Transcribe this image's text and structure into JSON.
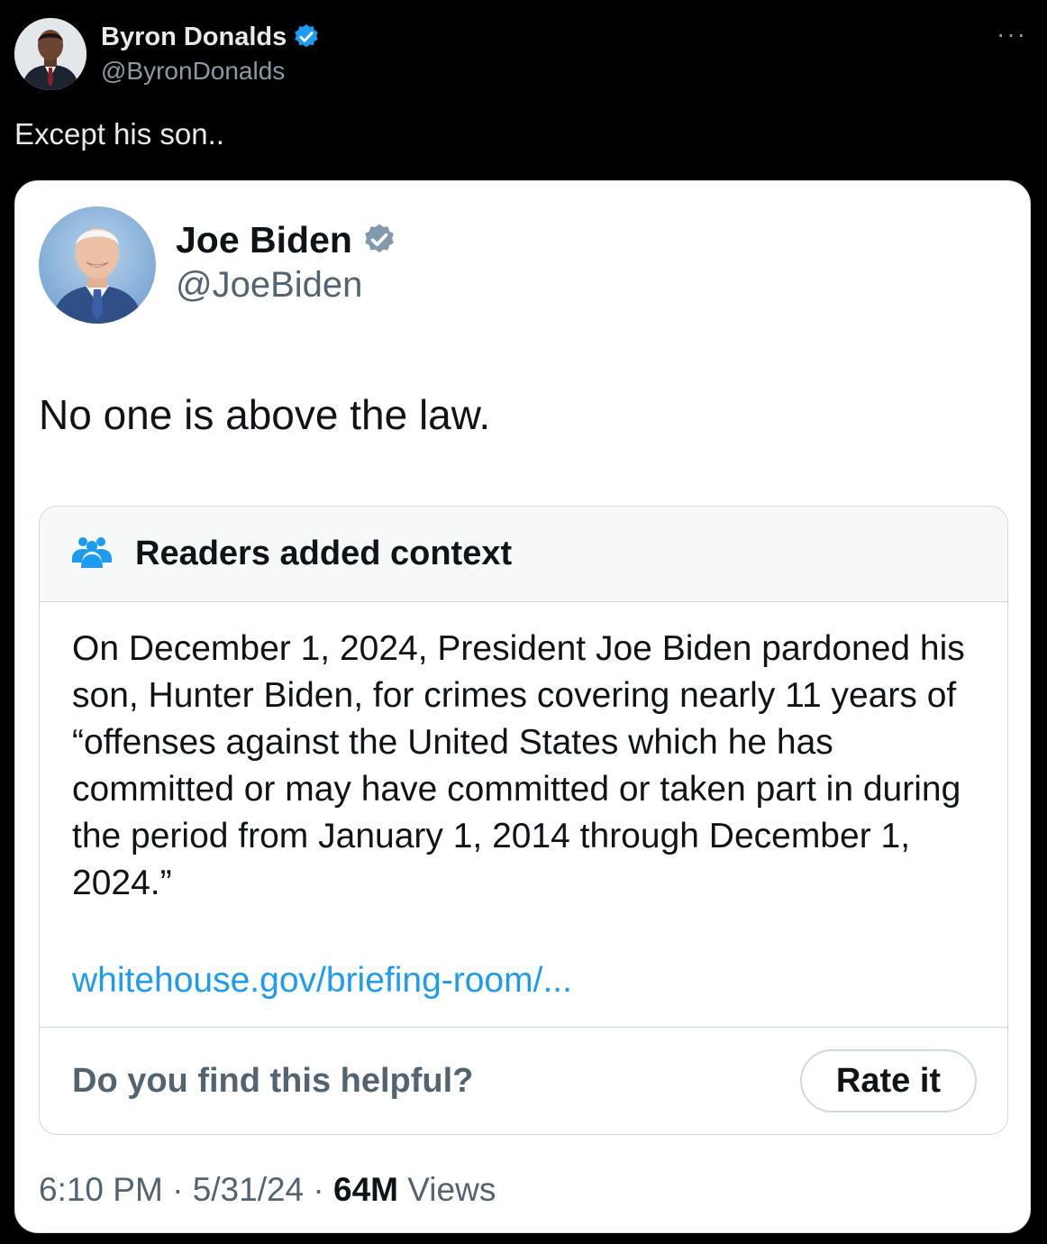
{
  "outer_tweet": {
    "author_name": "Byron Donalds",
    "author_handle": "@ByronDonalds",
    "more_label": "···",
    "text": "Except his son.."
  },
  "quoted_tweet": {
    "author_name": "Joe Biden",
    "author_handle": "@JoeBiden",
    "text": "No one is above the law.",
    "community_note": {
      "title": "Readers added context",
      "body": "On December 1, 2024, President Joe Biden pardoned his son, Hunter Biden, for crimes covering nearly 11 years of “offenses against the United States which he has committed or may have committed or taken part in during the period from January 1, 2014 through December 1, 2024.”",
      "link_text": "whitehouse.gov/briefing-room/...",
      "helpful_prompt": "Do you find this helpful?",
      "rate_label": "Rate it"
    },
    "meta": {
      "time": "6:10 PM",
      "separator": "·",
      "date": "5/31/24",
      "views_count": "64M",
      "views_label": "Views"
    }
  },
  "colors": {
    "background": "#000000",
    "card_background": "#ffffff",
    "verified_blue": "#1d9bf0",
    "verified_grey": "#829aab",
    "link_blue": "#1d9bf0"
  },
  "icons": [
    "verified-badge-icon",
    "more-icon",
    "community-notes-icon"
  ]
}
